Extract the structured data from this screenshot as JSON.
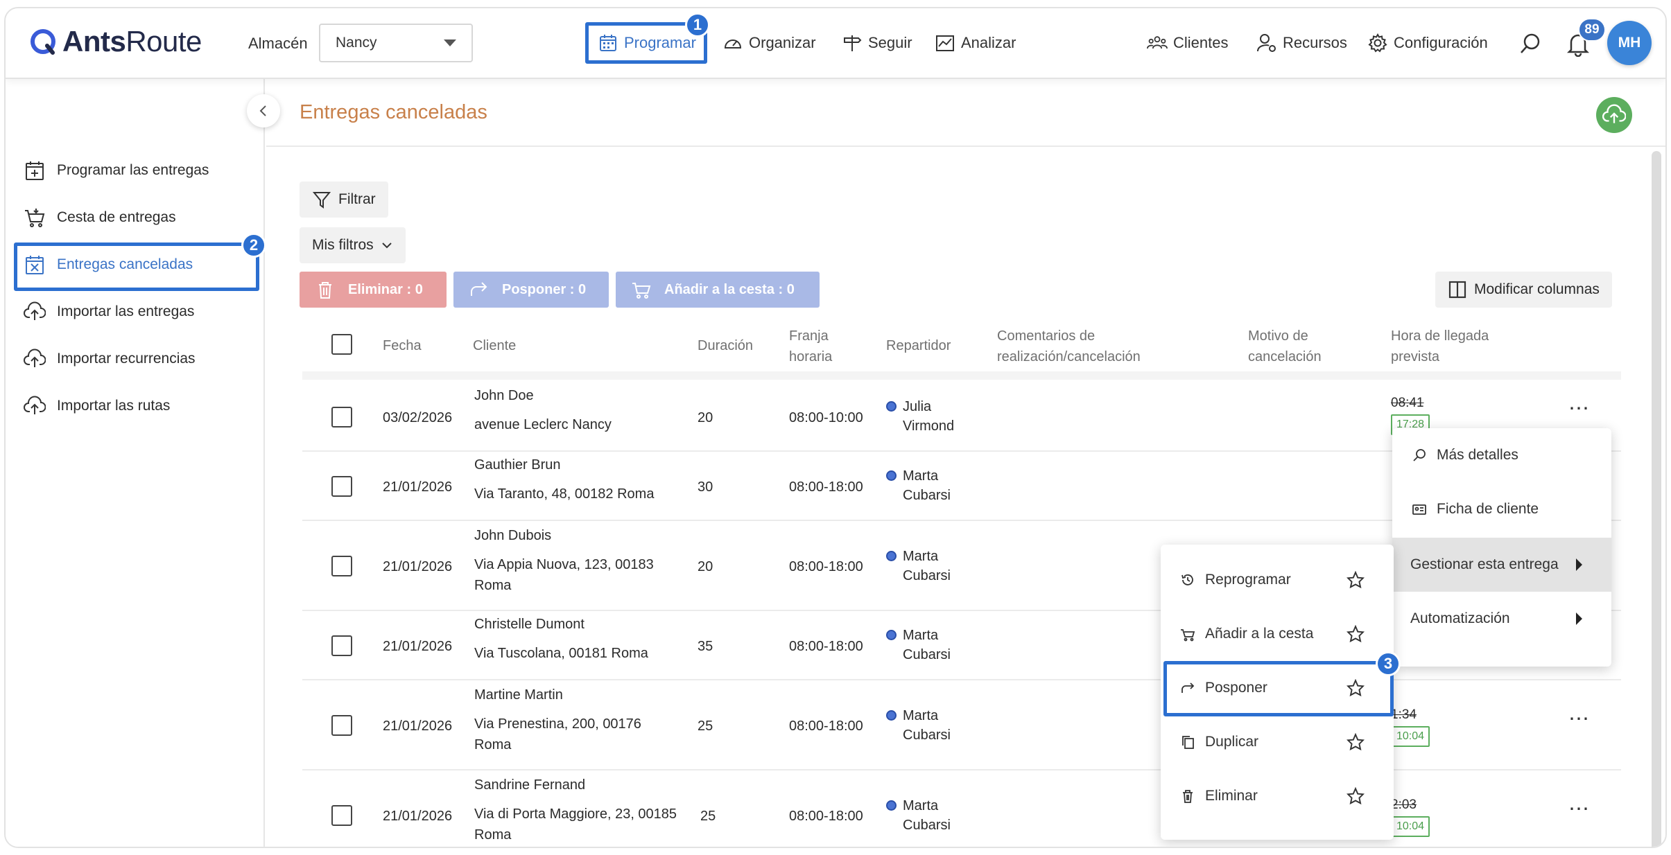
{
  "app": {
    "logo_main": "Ants",
    "logo_route": "Route"
  },
  "header": {
    "almacen_label": "Almacén",
    "almacen_value": "Nancy",
    "nav": {
      "programar": "Programar",
      "organizar": "Organizar",
      "seguir": "Seguir",
      "analizar": "Analizar",
      "clientes": "Clientes",
      "recursos": "Recursos",
      "configuracion": "Configuración"
    },
    "notifications_count": "89",
    "avatar_initials": "MH"
  },
  "steps": {
    "one": "1",
    "two": "2",
    "three": "3"
  },
  "sidebar": {
    "items": [
      {
        "label": "Programar las entregas",
        "icon": "calendar-plus-icon"
      },
      {
        "label": "Cesta de entregas",
        "icon": "cart-icon"
      },
      {
        "label": "Entregas canceladas",
        "icon": "calendar-x-icon"
      },
      {
        "label": "Importar las entregas",
        "icon": "cloud-upload-icon"
      },
      {
        "label": "Importar recurrencias",
        "icon": "cloud-upload-icon"
      },
      {
        "label": "Importar las rutas",
        "icon": "cloud-upload-icon"
      }
    ]
  },
  "main": {
    "title": "Entregas canceladas",
    "filter_label": "Filtrar",
    "my_filters_label": "Mis filtros",
    "bulk": {
      "delete": "Eliminar : 0",
      "postpone": "Posponer : 0",
      "add_basket": "Añadir a la cesta : 0"
    },
    "modify_columns": "Modificar columnas"
  },
  "table": {
    "headers": {
      "fecha": "Fecha",
      "cliente": "Cliente",
      "duracion": "Duración",
      "franja_1": "Franja",
      "franja_2": "horaria",
      "repartidor": "Repartidor",
      "comentarios_1": "Comentarios de",
      "comentarios_2": "realización/cancelación",
      "motivo_1": "Motivo de",
      "motivo_2": "cancelación",
      "hora_1": "Hora de llegada",
      "hora_2": "prevista"
    },
    "rows": [
      {
        "fecha": "03/02/2026",
        "cliente": "John Doe",
        "direccion_1": "avenue Leclerc Nancy",
        "direccion_2": "",
        "duracion": "20",
        "franja": "08:00-10:00",
        "rep_1": "Julia",
        "rep_2": "Virmond",
        "hora_old": "08:41",
        "hora_new": "17:28"
      },
      {
        "fecha": "21/01/2026",
        "cliente": "Gauthier Brun",
        "direccion_1": "Via Taranto, 48, 00182 Roma",
        "direccion_2": "",
        "duracion": "30",
        "franja": "08:00-18:00",
        "rep_1": "Marta",
        "rep_2": "Cubarsi",
        "hora_old": "",
        "hora_new": ""
      },
      {
        "fecha": "21/01/2026",
        "cliente": "John Dubois",
        "direccion_1": "Via Appia Nuova, 123, 00183",
        "direccion_2": "Roma",
        "duracion": "20",
        "franja": "08:00-18:00",
        "rep_1": "Marta",
        "rep_2": "Cubarsi",
        "hora_old": "",
        "hora_new": ""
      },
      {
        "fecha": "21/01/2026",
        "cliente": "Christelle Dumont",
        "direccion_1": "Via Tuscolana, 00181 Roma",
        "direccion_2": "",
        "duracion": "35",
        "franja": "08:00-18:00",
        "rep_1": "Marta",
        "rep_2": "Cubarsi",
        "hora_old": "",
        "hora_new": ""
      },
      {
        "fecha": "21/01/2026",
        "cliente": "Martine Martin",
        "direccion_1": "Via Prenestina, 200, 00176",
        "direccion_2": "Roma",
        "duracion": "25",
        "franja": "08:00-18:00",
        "rep_1": "Marta",
        "rep_2": "Cubarsi",
        "hora_old": "1:34",
        "hora_new": "10:04"
      },
      {
        "fecha": "21/01/2026",
        "cliente": "Sandrine Fernand",
        "direccion_1": "Via di Porta Maggiore, 23, 00185",
        "direccion_2": "Roma",
        "duracion": "25",
        "franja": "08:00-18:00",
        "rep_1": "Marta",
        "rep_2": "Cubarsi",
        "hora_old": "2:03",
        "hora_new": "10:04"
      }
    ]
  },
  "context_menu": {
    "mas_detalles": "Más detalles",
    "ficha_cliente": "Ficha de cliente",
    "gestionar": "Gestionar esta entrega",
    "automatizacion": "Automatización"
  },
  "submenu": {
    "reprogramar": "Reprogramar",
    "anadir_cesta": "Añadir a la cesta",
    "posponer": "Posponer",
    "duplicar": "Duplicar",
    "eliminar": "Eliminar"
  },
  "colors": {
    "accent": "#3a73c6",
    "highlight": "#2c6fd0",
    "title": "#c8804a",
    "delete_btn": "#e8a0a0",
    "postpone_btn": "#a9b9e6",
    "success": "#5cae5e"
  }
}
